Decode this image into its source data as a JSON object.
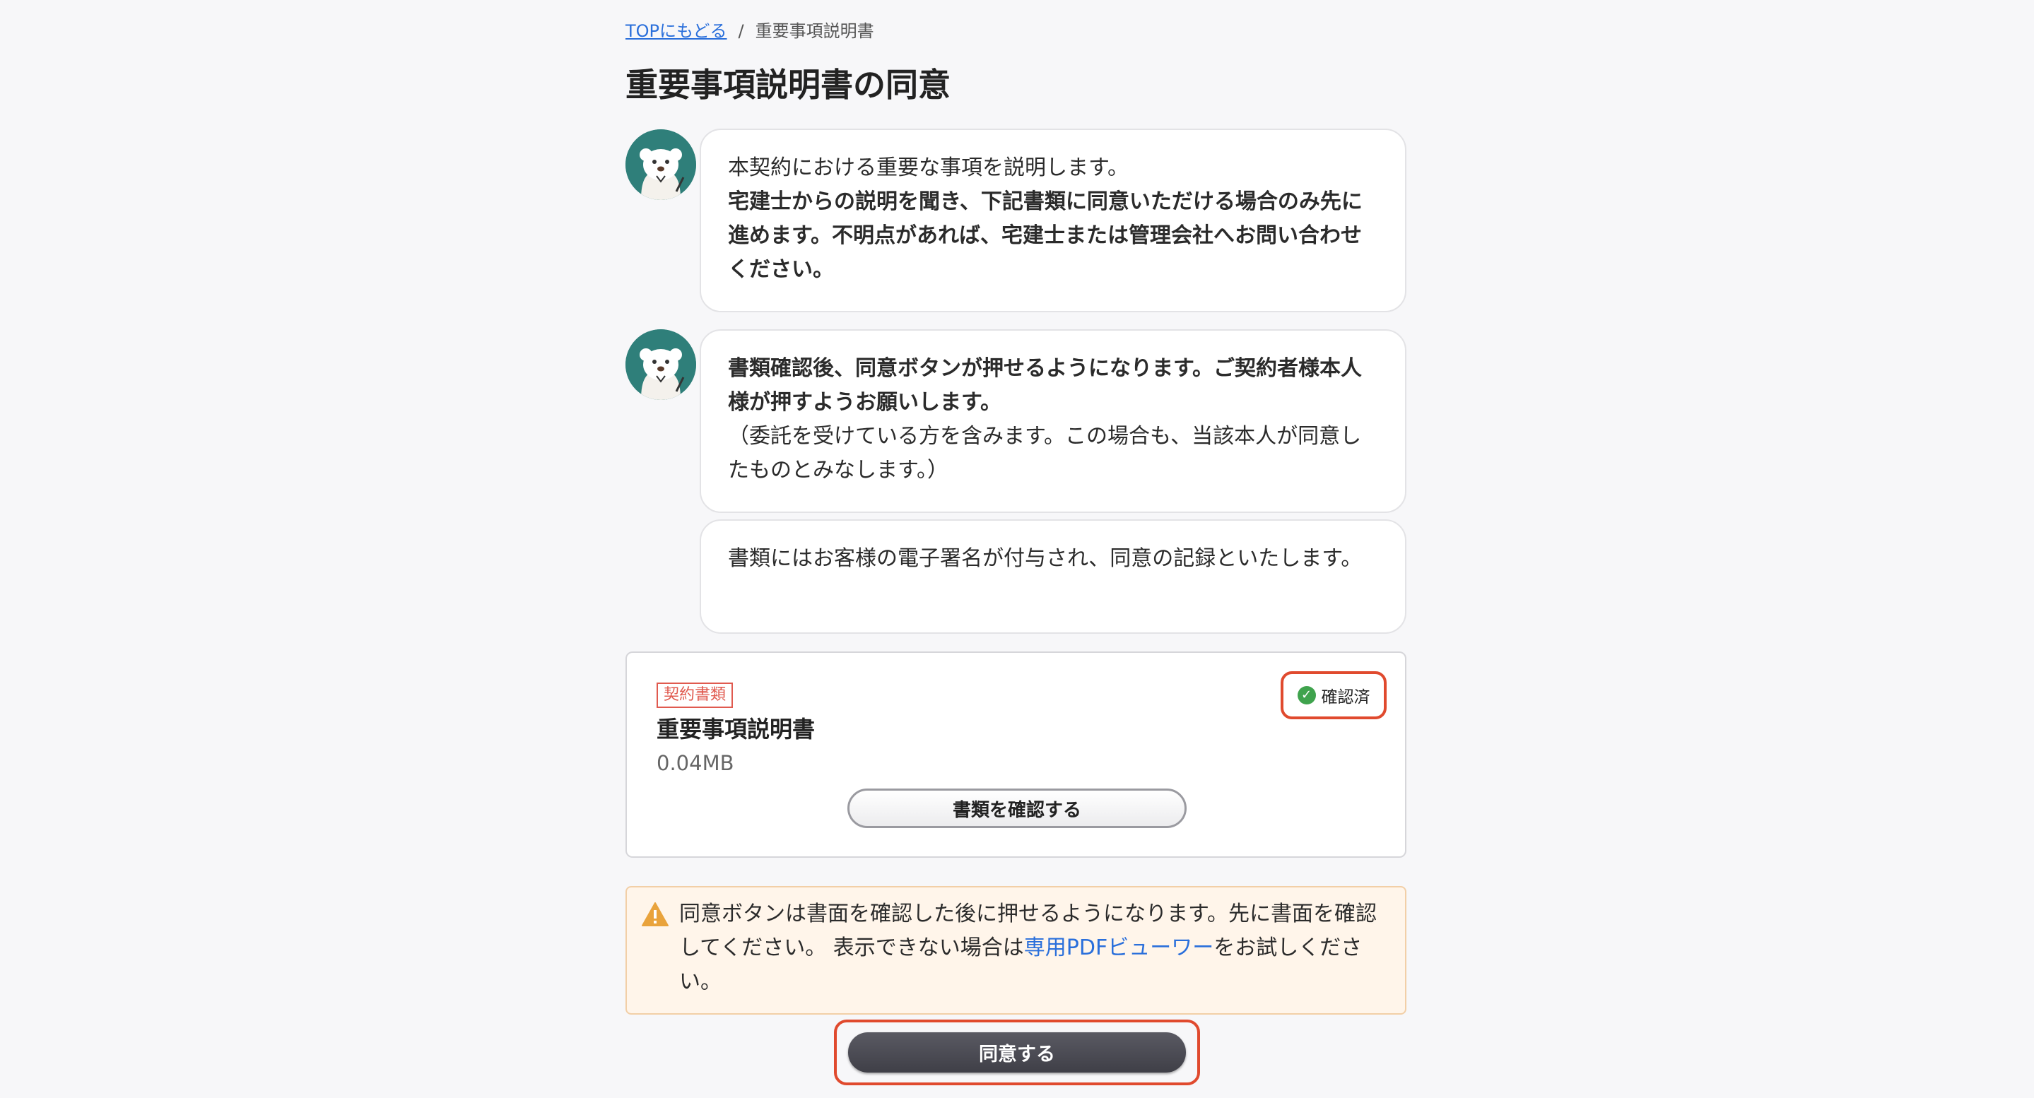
{
  "breadcrumb": {
    "top_link": "TOPにもどる",
    "separator": "/",
    "current": "重要事項説明書"
  },
  "page_title": "重要事項説明書の同意",
  "messages": {
    "m1_line1": "本契約における重要な事項を説明します。",
    "m1_bold": "宅建士からの説明を聞き、下記書類に同意いただける場合のみ先に進めます。不明点があれば、宅建士または管理会社へお問い合わせください。",
    "m2_bold": "書類確認後、同意ボタンが押せるようになります。ご契約者様本人様が押すようお願いします。",
    "m2_note": "（委託を受けている方を含みます。この場合も、当該本人が同意したものとみなします。）",
    "m3": "書類にはお客様の電子署名が付与され、同意の記録といたします。"
  },
  "document": {
    "tag": "契約書類",
    "title": "重要事項説明書",
    "size": "0.04MB",
    "status": "確認済",
    "view_button": "書類を確認する"
  },
  "notice": {
    "text_before": "同意ボタンは書面を確認した後に押せるようになります。先に書面を確認してください。 表示できない場合は",
    "link": "専用PDFビューワー",
    "text_after": "をお試しください。"
  },
  "agree_button": "同意する",
  "icons": {
    "avatar": "polar-bear-avatar",
    "status": "check-circle-icon",
    "notice": "warning-triangle-icon"
  },
  "colors": {
    "link": "#2a6fdb",
    "highlight_border": "#e04a2e",
    "tag": "#e05a4f",
    "check": "#3fa34d",
    "avatar_bg": "#2f7f7a",
    "notice_bg": "#fff5ea",
    "agree_button_bg": "#4a4a52"
  }
}
